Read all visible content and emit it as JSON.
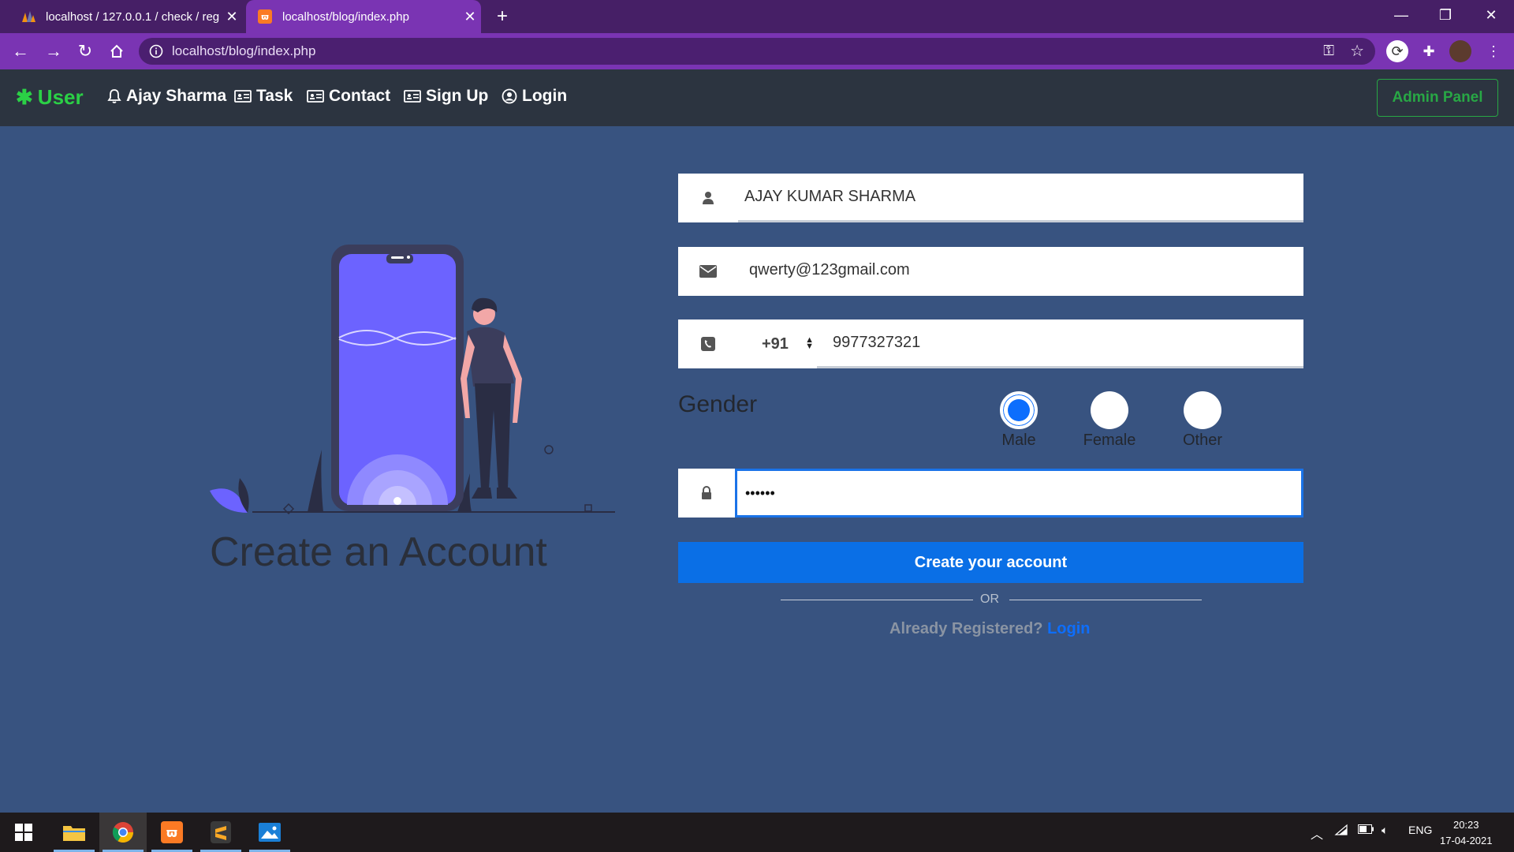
{
  "browser": {
    "tabs": [
      {
        "title": "localhost / 127.0.0.1 / check / reg",
        "active": false
      },
      {
        "title": "localhost/blog/index.php",
        "active": true
      }
    ],
    "url": "localhost/blog/index.php"
  },
  "navbar": {
    "brand": "User",
    "links": [
      "Ajay Sharma",
      "Task",
      "Contact",
      "Sign Up",
      "Login"
    ],
    "admin_button": "Admin Panel"
  },
  "illustration": {
    "heading": "Create an Account"
  },
  "form": {
    "name_value": "AJAY KUMAR SHARMA",
    "email_value": "qwerty@123gmail.com",
    "phone_code": "+91",
    "phone_value": "9977327321",
    "gender_label": "Gender",
    "gender_options": [
      "Male",
      "Female",
      "Other"
    ],
    "gender_selected": "Male",
    "password_value": "••••••",
    "submit_label": "Create your account",
    "or_text": "OR",
    "already_text": "Already Registered?",
    "login_link": "Login"
  },
  "taskbar": {
    "language": "ENG",
    "time": "20:23",
    "date": "17-04-2021"
  },
  "colors": {
    "background": "#385380",
    "navbar": "#2c3440",
    "brand_green": "#2bd046",
    "primary_blue": "#0a6fe6",
    "browser_purple": "#7a34b3"
  }
}
